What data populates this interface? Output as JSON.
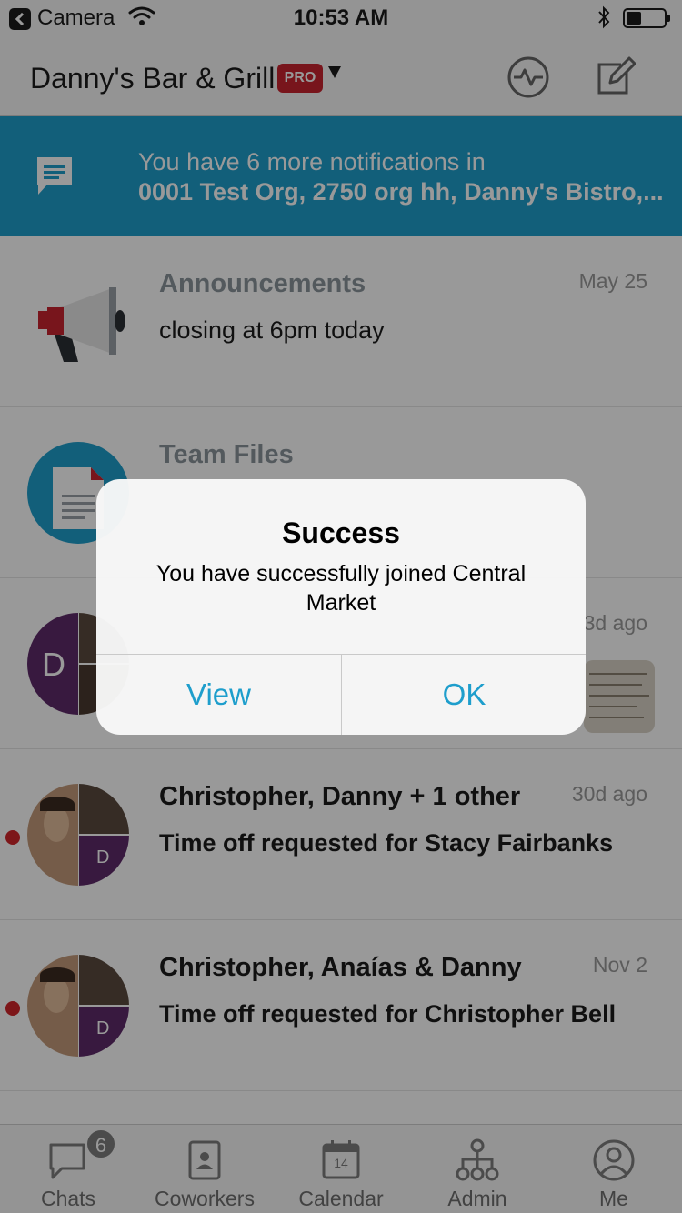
{
  "status_bar": {
    "back_app": "Camera",
    "time": "10:53 AM"
  },
  "nav": {
    "title": "Danny's Bar & Grill",
    "badge": "PRO"
  },
  "banner": {
    "line1": "You have 6 more notifications in",
    "line2": "0001 Test Org, 2750 org hh, Danny's Bistro,..."
  },
  "chats": [
    {
      "title": "Announcements",
      "subtitle": "closing at 6pm today",
      "date": "May 25",
      "unread": false,
      "icon": "megaphone-icon"
    },
    {
      "title": "Team Files",
      "subtitle": "",
      "date": "",
      "unread": false,
      "icon": "file-icon"
    },
    {
      "title": "",
      "subtitle": "",
      "date": "3d ago",
      "unread": false,
      "avatar_letter": "D"
    },
    {
      "title": "Christopher, Danny + 1 other",
      "subtitle": "Time off requested for Stacy Fairbanks",
      "date": "30d ago",
      "unread": true,
      "avatar_letter": "D"
    },
    {
      "title": "Christopher, Anaías & Danny",
      "subtitle": "Time off requested for Christopher Bell",
      "date": "Nov 2",
      "unread": true,
      "avatar_letter": "D"
    }
  ],
  "tabs": [
    {
      "label": "Chats",
      "icon": "chat-bubble-icon",
      "badge": "6"
    },
    {
      "label": "Coworkers",
      "icon": "contact-book-icon"
    },
    {
      "label": "Calendar",
      "icon": "calendar-icon",
      "day": "14"
    },
    {
      "label": "Admin",
      "icon": "org-chart-icon"
    },
    {
      "label": "Me",
      "icon": "user-circle-icon"
    }
  ],
  "alert": {
    "title": "Success",
    "message": "You have successfully joined Central Market",
    "buttons": [
      "View",
      "OK"
    ]
  },
  "colors": {
    "accent": "#1e9ecc",
    "pro_badge": "#c8242f",
    "unread_dot": "#d0252a",
    "group_avatar": "#5e2a69"
  }
}
